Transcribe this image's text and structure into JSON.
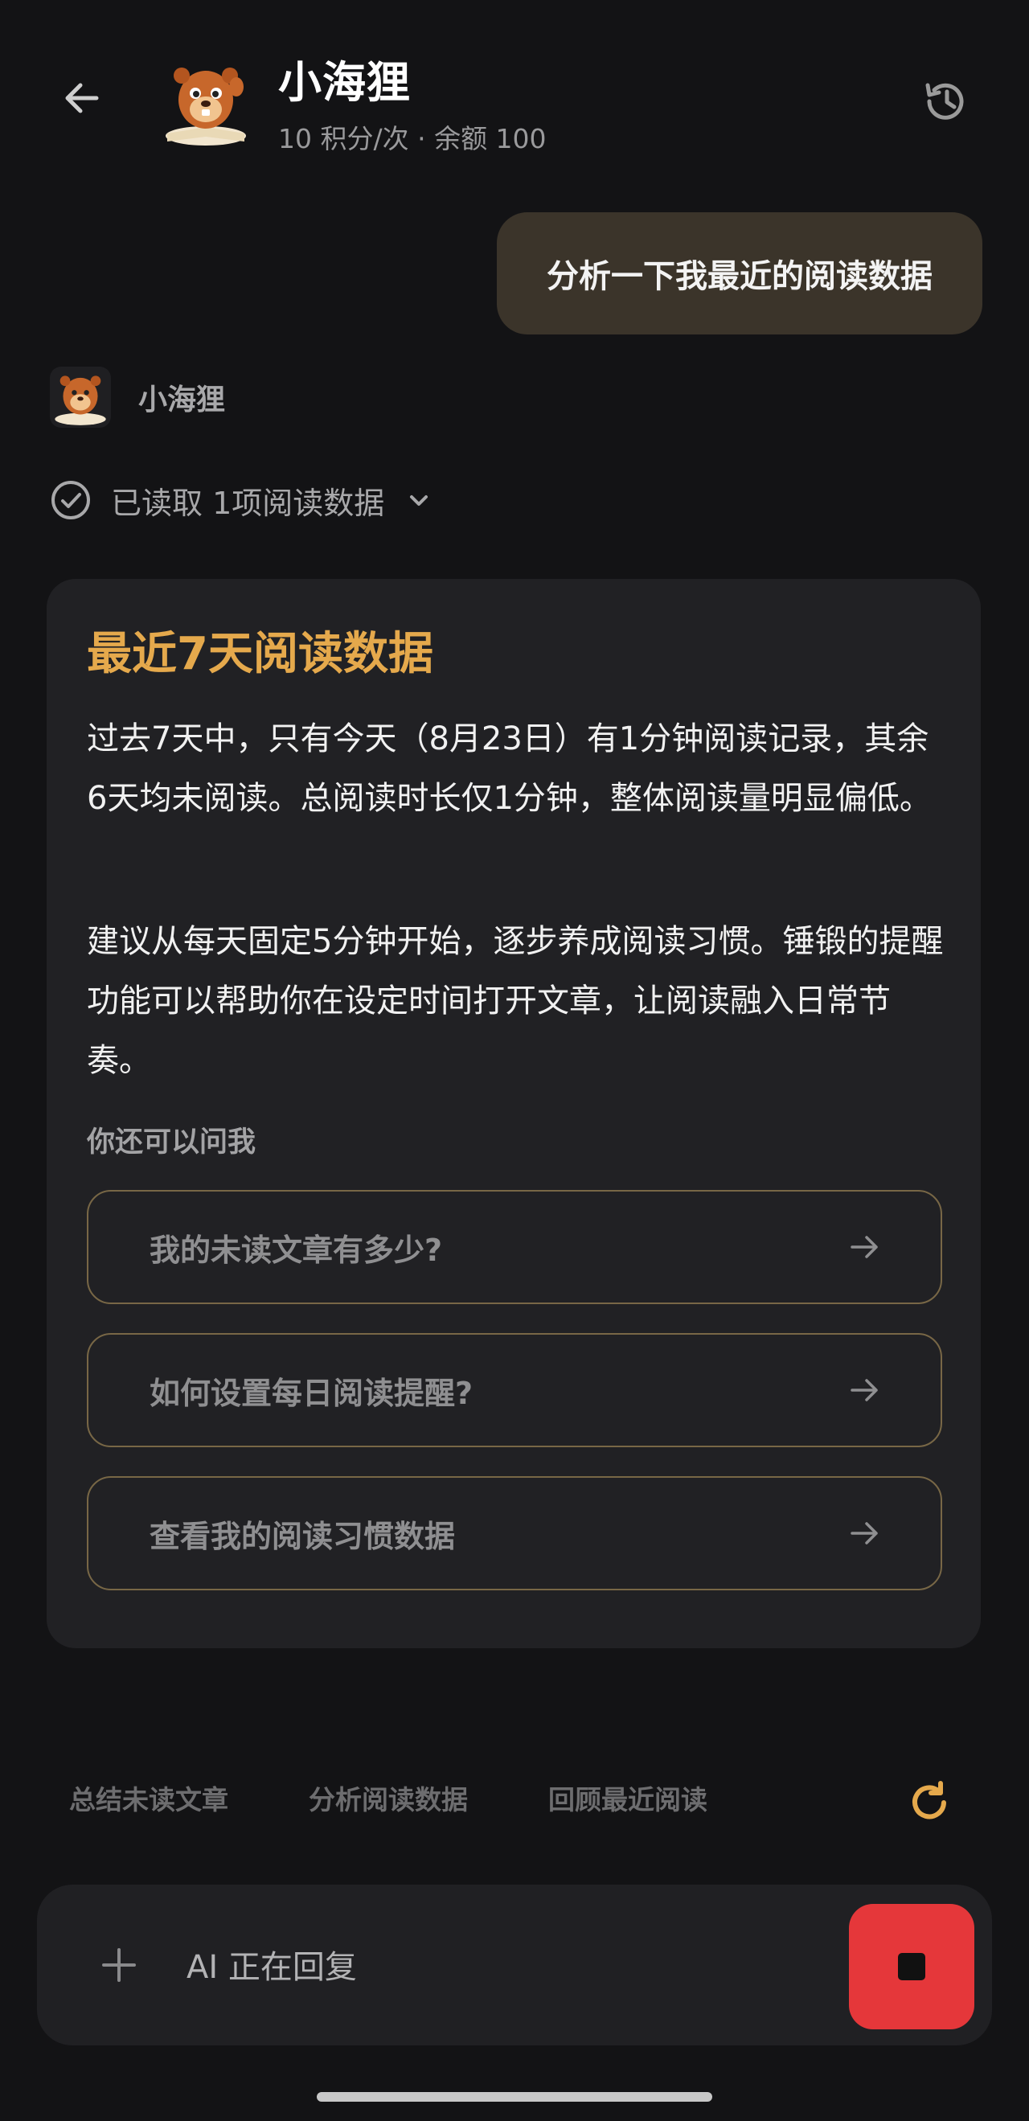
{
  "header": {
    "title": "小海狸",
    "subtitle": "10 积分/次 · 余额 100",
    "back_icon": "arrow-left-icon",
    "history_icon": "history-icon"
  },
  "user_message": "分析一下我最近的阅读数据",
  "bot": {
    "name": "小海狸",
    "read_status": "已读取 1项阅读数据"
  },
  "card": {
    "title": "最近7天阅读数据",
    "paragraphs": [
      "过去7天中，只有今天（8月23日）有1分钟阅读记录，其余6天均未阅读。总阅读时长仅1分钟，整体阅读量明显偏低。",
      "建议从每天固定5分钟开始，逐步养成阅读习惯。锤锻的提醒功能可以帮助你在设定时间打开文章，让阅读融入日常节奏。"
    ],
    "ask_label": "你还可以问我",
    "suggestions": [
      "我的未读文章有多少?",
      "如何设置每日阅读提醒?",
      "查看我的阅读习惯数据"
    ]
  },
  "quick_chips": [
    "总结未读文章",
    "分析阅读数据",
    "回顾最近阅读"
  ],
  "input": {
    "status_text": "AI 正在回复"
  },
  "colors": {
    "background": "#131315",
    "card": "#212124",
    "accent_gold": "#e5a94c",
    "user_bubble": "#3b342a",
    "stop_red": "#e5373a"
  }
}
